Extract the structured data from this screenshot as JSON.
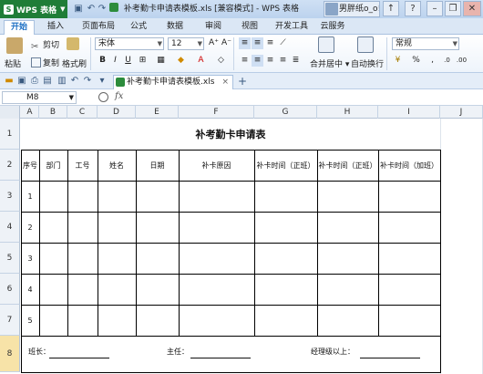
{
  "app": {
    "menu_label": "WPS 表格",
    "window_title": "补考勤卡申请表模板.xls [兼容模式] - WPS 表格",
    "user_name": "男胖纸o_o!",
    "tabs": [
      "开始",
      "插入",
      "页面布局",
      "公式",
      "数据",
      "审阅",
      "视图",
      "开发工具",
      "云服务"
    ],
    "active_tab": "开始"
  },
  "ribbon": {
    "paste": "粘贴",
    "cut": "剪切",
    "copy": "复制",
    "format_painter": "格式刷",
    "font_name": "宋体",
    "font_size": "12",
    "merge_center": "合并居中",
    "wrap_text": "自动换行",
    "number_format": "常规",
    "bold": "B",
    "italic": "I",
    "underline": "U",
    "percent": "%",
    "comma": ","
  },
  "document": {
    "tab_name": "补考勤卡申请表模板.xls",
    "add_tab": "+"
  },
  "formula_bar": {
    "name_box": "M8",
    "fx": "fx",
    "content": ""
  },
  "sheet": {
    "columns": [
      "A",
      "B",
      "C",
      "D",
      "E",
      "F",
      "G",
      "H",
      "I",
      "J"
    ],
    "rows": [
      "1",
      "2",
      "3",
      "4",
      "5",
      "6",
      "7",
      "8"
    ],
    "selected_row": "8",
    "title": "补考勤卡申请表",
    "headers": [
      "序号",
      "部门",
      "工号",
      "姓名",
      "日期",
      "补卡原因",
      "补卡时间（正班）",
      "补卡时间（正班）",
      "补卡时间（加班）"
    ],
    "row_numbers": [
      "1",
      "2",
      "3",
      "4",
      "5"
    ],
    "footer": {
      "leader": "班长：",
      "supervisor": "主任：",
      "manager": "经理级以上："
    }
  }
}
